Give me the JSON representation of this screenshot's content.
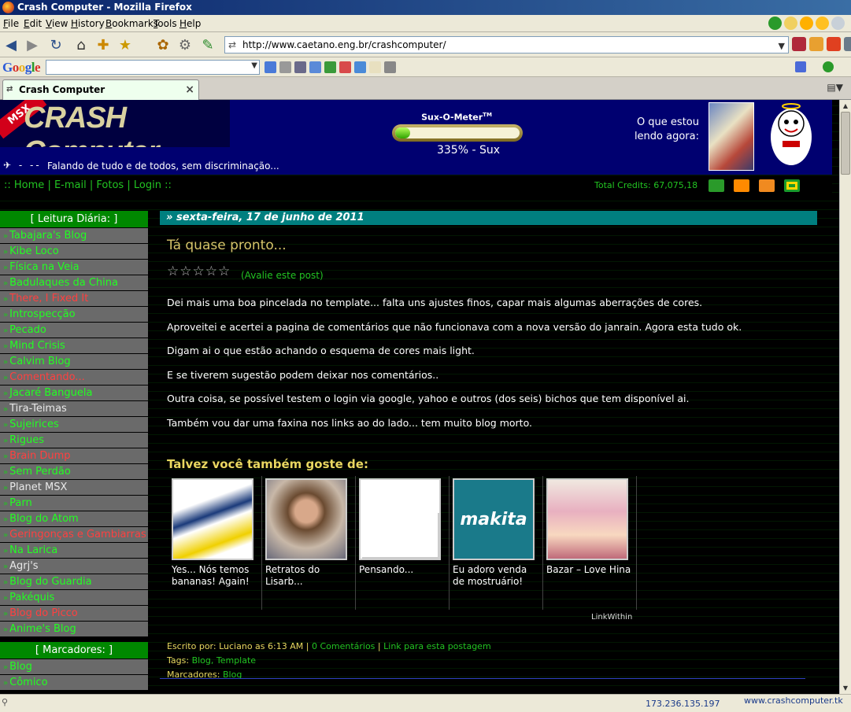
{
  "window": {
    "title": "Crash Computer - Mozilla Firefox"
  },
  "menu": [
    "File",
    "Edit",
    "View",
    "History",
    "Bookmarks",
    "Tools",
    "Help"
  ],
  "navigation": {
    "url": "http://www.caetano.eng.br/crashcomputer/"
  },
  "google_toolbar": {
    "logo": "Google",
    "search_value": ""
  },
  "tab": {
    "title": "Crash Computer"
  },
  "header": {
    "logo_badge": "MSX",
    "logo_text": "CRASH Computer",
    "tagline": "Falando de tudo e de todos, sem discriminação...",
    "meter_title": "Sux-O-Meter",
    "meter_tm": "TM",
    "meter_fraction": 0.12,
    "meter_value": "335% - Sux",
    "reading_label": "O que estou lendo agora:"
  },
  "topnav": {
    "prefix": "::",
    "links": [
      "Home",
      "E-mail",
      "Fotos",
      "Login"
    ],
    "separator": "|",
    "suffix": "::",
    "credits": "Total Credits: 67,075,18"
  },
  "sidebar": {
    "leitura_title": "[ Leitura Diária: ]",
    "blogs": [
      {
        "label": "Tabajara's Blog",
        "color": "green"
      },
      {
        "label": "Kibe Loco",
        "color": "green"
      },
      {
        "label": "Física na Veia",
        "color": "green"
      },
      {
        "label": "Badulaques da China",
        "color": "green"
      },
      {
        "label": "There, I Fixed It",
        "color": "red"
      },
      {
        "label": "Introspecção",
        "color": "green"
      },
      {
        "label": "Pecado",
        "color": "green"
      },
      {
        "label": "Mind Crisis",
        "color": "green"
      },
      {
        "label": "Calvim Blog",
        "color": "green"
      },
      {
        "label": "Comentando...",
        "color": "red"
      },
      {
        "label": "Jacaré Banguela",
        "color": "green"
      },
      {
        "label": "Tira-Teimas",
        "color": "white"
      },
      {
        "label": "Sujeirices",
        "color": "green"
      },
      {
        "label": "Rigues",
        "color": "green"
      },
      {
        "label": "Brain Dump",
        "color": "red"
      },
      {
        "label": "Sem Perdão",
        "color": "green"
      },
      {
        "label": "Planet MSX",
        "color": "white"
      },
      {
        "label": "Parn",
        "color": "green"
      },
      {
        "label": "Blog do Atom",
        "color": "green"
      },
      {
        "label": "Geringonças e Gambiarras",
        "color": "red"
      },
      {
        "label": "Na Larica",
        "color": "green"
      },
      {
        "label": "Agrj's",
        "color": "white"
      },
      {
        "label": "Blog do Guardia",
        "color": "green"
      },
      {
        "label": "Pakéquis",
        "color": "green"
      },
      {
        "label": "Blog do Picco",
        "color": "red"
      },
      {
        "label": "Anime's Blog",
        "color": "green"
      }
    ],
    "marcadores_title": "[ Marcadores: ]",
    "marcadores": [
      "Blog",
      "Cômico"
    ]
  },
  "post": {
    "date": "» sexta-feira, 17 de junho de 2011",
    "title": "Tá quase pronto...",
    "stars": "☆☆☆☆☆",
    "rate_link": "(Avalie este post)",
    "paragraphs": [
      "Dei mais uma boa pincelada no template... falta uns ajustes finos, capar mais algumas aberrações de cores.",
      "Aproveitei e acertei a pagina de comentários que não funcionava com a nova versão do janrain. Agora esta tudo ok.",
      "Digam ai o que estão achando o esquema de cores mais light.",
      "E se tiverem sugestão podem deixar nos comentários..",
      "Outra coisa, se possível testem o login via google, yahoo e outros (dos seis) bichos que tem disponível ai.",
      "Também vou dar uma faxina nos links ao do lado... tem muito blog morto."
    ],
    "related_title": "Talvez você também goste de:",
    "related": [
      {
        "caption": "Yes... Nós temos bananas! Again!"
      },
      {
        "caption": "Retratos do Lisarb..."
      },
      {
        "caption": "Pensando..."
      },
      {
        "caption": "Eu adoro venda de mostruário!"
      },
      {
        "caption": "Bazar – Love Hina"
      }
    ],
    "linkwithin": "LinkWithin",
    "footer": {
      "written_by": "Escrito por: Luciano as 6:13 AM",
      "comments": "0 Comentários",
      "permalink": "Link para esta postagem",
      "tags_label": "Tags:",
      "tags": "Blog, Template",
      "labels_label": "Marcadores:",
      "labels": "Blog"
    }
  },
  "status": {
    "ip": "173.236.135.197",
    "right_text": "www.crashcomputer.tk"
  },
  "colors": {
    "banner": "#000070",
    "accent_green": "#22c422",
    "date_bar": "#007f7f",
    "title_gold": "#d6c46a"
  }
}
